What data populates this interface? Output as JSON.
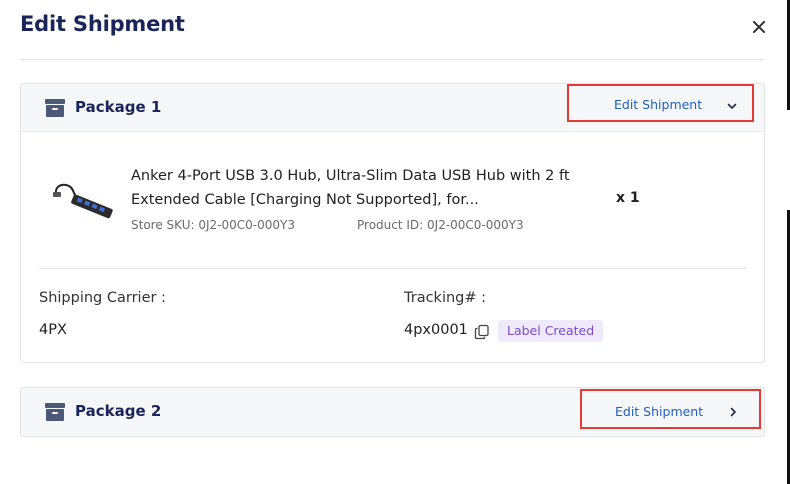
{
  "modal": {
    "title": "Edit Shipment",
    "close_icon": "close-icon"
  },
  "packages": [
    {
      "name": "Package 1",
      "icon": "package-box-icon",
      "edit_label": "Edit Shipment",
      "expanded": true,
      "chevron_icon": "chevron-down-icon",
      "product": {
        "thumbnail_icon": "usb-hub-image",
        "name": "Anker 4-Port USB 3.0 Hub, Ultra-Slim Data USB Hub with 2 ft Extended Cable [Charging Not Supported], for...",
        "store_sku": "Store SKU: 0J2-00C0-000Y3",
        "product_id": "Product ID: 0J2-00C0-000Y3",
        "quantity": "x 1"
      },
      "shipping_carrier_label": "Shipping Carrier :",
      "shipping_carrier": "4PX",
      "tracking_label": "Tracking# :",
      "tracking_number": "4px0001",
      "copy_icon": "copy-icon",
      "status_badge": "Label Created"
    },
    {
      "name": "Package 2",
      "icon": "package-box-icon",
      "edit_label": "Edit Shipment",
      "expanded": false,
      "chevron_icon": "chevron-right-icon"
    }
  ],
  "colors": {
    "title": "#1b2559",
    "link": "#1f5fbf",
    "highlight_border": "#e53935",
    "badge_bg": "#efeafb",
    "badge_text": "#7b4bc9"
  }
}
